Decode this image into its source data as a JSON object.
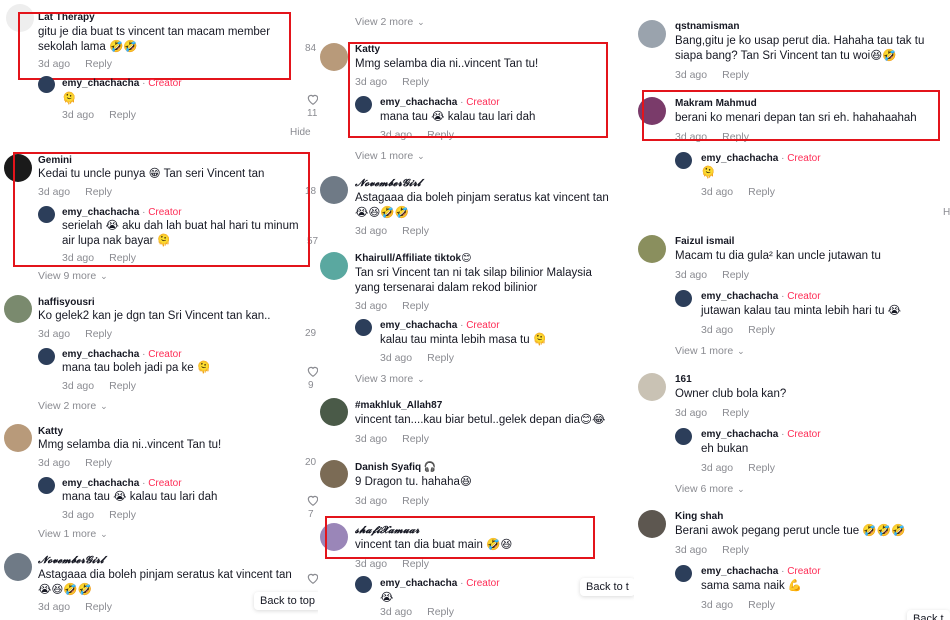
{
  "ui": {
    "reply": "Reply",
    "creator_tag": "Creator",
    "separator": "·",
    "back_to_top": "Back to top",
    "back_to_top_cut": "Back to t",
    "back_cut2": "Back t",
    "hide": "Hide",
    "partial_hide": "H"
  },
  "colors": {
    "creator": "#fe2c55",
    "box": "#e3141b",
    "muted": "#8a8b91"
  },
  "panel1": {
    "c1": {
      "user": "Lat Therapy",
      "text": "gitu je dia buat ts vincent tan macam member sekolah lama 🤣🤣",
      "time": "3d ago",
      "likes": "84"
    },
    "r1": {
      "user": "emy_chachacha",
      "text": "🫠",
      "time": "3d ago",
      "likes": "11"
    },
    "c2": {
      "user": "Gemini",
      "text": "Kedai tu uncle punya 😁 Tan seri Vincent tan",
      "time": "3d ago",
      "likes": "18"
    },
    "r2": {
      "user": "emy_chachacha",
      "text": "serielah 😭 aku dah lah buat hal hari tu minum air lupa nak bayar 🫠",
      "time": "3d ago",
      "likes": "57"
    },
    "more2": "View 9 more",
    "c3": {
      "user": "haffisyousri",
      "text": "Ko gelek2 kan je dgn tan Sri Vincent tan kan..",
      "time": "3d ago",
      "likes": "29"
    },
    "r3": {
      "user": "emy_chachacha",
      "text": "mana tau boleh jadi pa ke 🫠",
      "time": "3d ago",
      "likes": "9"
    },
    "more3": "View 2 more",
    "c4": {
      "user": "Katty",
      "text": "Mmg selamba dia ni..vincent Tan tu!",
      "time": "3d ago",
      "likes": "20"
    },
    "r4": {
      "user": "emy_chachacha",
      "text": "mana tau 😭 kalau tau lari dah",
      "time": "3d ago",
      "likes": "7"
    },
    "more4": "View 1 more",
    "c5": {
      "user": "𝓝𝓸𝓿𝓮𝓶𝓫𝓮𝓻𝓖𝓲𝓻𝓵",
      "text": "Astagaaa dia boleh pinjam seratus kat vincent tan 😭😆🤣🤣",
      "time": "3d ago"
    }
  },
  "panel2": {
    "more0": "View 2 more",
    "c1": {
      "user": "Katty",
      "text": "Mmg selamba dia ni..vincent Tan tu!",
      "time": "3d ago"
    },
    "r1": {
      "user": "emy_chachacha",
      "text": "mana tau 😭 kalau tau lari dah",
      "time": "3d ago"
    },
    "more1": "View 1 more",
    "c2": {
      "user": "𝓝𝓸𝓿𝓮𝓶𝓫𝓮𝓻𝓖𝓲𝓻𝓵",
      "text": "Astagaaa dia boleh pinjam seratus kat vincent tan 😭😆🤣🤣",
      "time": "3d ago"
    },
    "c3": {
      "user": "Khairull/Affiliate tiktok😊",
      "text": "Tan sri Vincent tan ni tak silap bilinior Malaysia yang tersenarai dalam rekod bilinior",
      "time": "3d ago"
    },
    "r3": {
      "user": "emy_chachacha",
      "text": "kalau tau minta lebih masa tu 🫠",
      "time": "3d ago"
    },
    "more3": "View 3 more",
    "c4": {
      "user": "#makhluk_Allah87",
      "text": "vincent tan....kau biar betul..gelek depan dia😊😂",
      "time": "3d ago"
    },
    "c5": {
      "user": "Danish Syafiq 🎧",
      "text": "9 Dragon tu. hahaha😆",
      "time": "3d ago"
    },
    "c6": {
      "user": "𝓼𝓱𝓪𝓯𝓲𝓧𝓪𝓶𝓾𝓪𝓻",
      "text": "vincent tan dia buat main 🤣😆",
      "time": "3d ago"
    },
    "r6": {
      "user": "emy_chachacha",
      "text": "😭",
      "time": "3d ago"
    }
  },
  "panel3": {
    "c1": {
      "user": "qstnamisman",
      "text": "Bang,gitu je ko usap perut dia. Hahaha tau tak tu siapa bang? Tan Sri Vincent tan tu woi😆🤣",
      "time": "3d ago"
    },
    "c2": {
      "user": "Makram Mahmud",
      "text": "berani ko menari depan tan sri eh. hahahaahah",
      "time": "3d ago"
    },
    "r2": {
      "user": "emy_chachacha",
      "text": "🫠",
      "time": "3d ago"
    },
    "c3": {
      "user": "Faizul ismail",
      "text": "Macam tu dia gula² kan uncle jutawan tu",
      "time": "3d ago"
    },
    "r3": {
      "user": "emy_chachacha",
      "text": "jutawan kalau tau minta lebih hari tu 😭",
      "time": "3d ago"
    },
    "more3": "View 1 more",
    "c4": {
      "user": "161",
      "text": "Owner club bola kan?",
      "time": "3d ago"
    },
    "r4": {
      "user": "emy_chachacha",
      "text": "eh bukan",
      "time": "3d ago"
    },
    "more4": "View 6 more",
    "c5": {
      "user": "King shah",
      "text": "Berani awok pegang perut uncle tue 🤣🤣🤣",
      "time": "3d ago"
    },
    "r5": {
      "user": "emy_chachacha",
      "text": "sama sama naik 💪",
      "time": "3d ago"
    }
  }
}
